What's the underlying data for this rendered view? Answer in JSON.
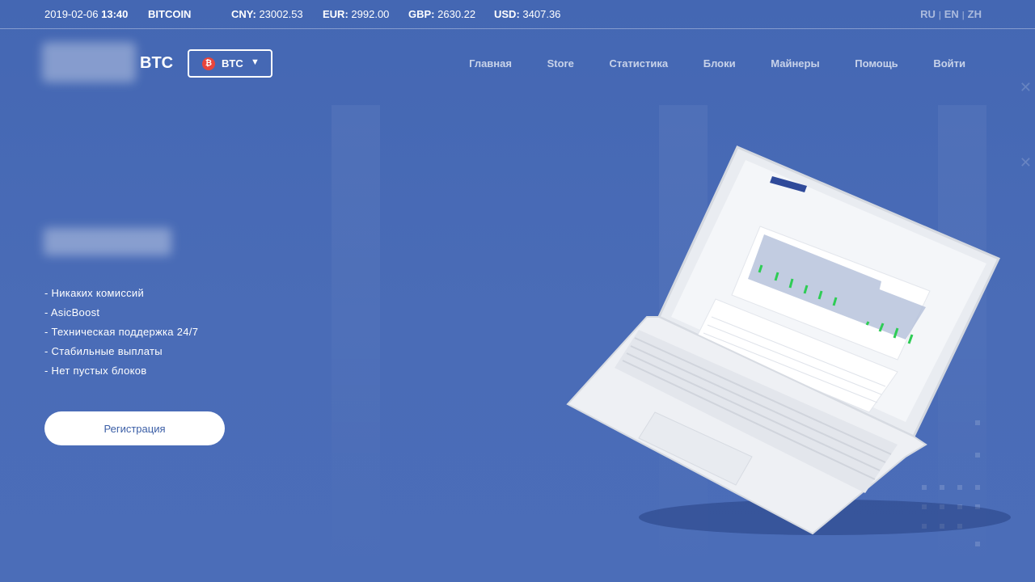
{
  "ticker": {
    "date": "2019-02-06",
    "time": "13:40",
    "coin": "BITCOIN",
    "rates": [
      {
        "label": "CNY:",
        "value": "23002.53"
      },
      {
        "label": "EUR:",
        "value": "2992.00"
      },
      {
        "label": "GBP:",
        "value": "2630.22"
      },
      {
        "label": "USD:",
        "value": "3407.36"
      }
    ]
  },
  "languages": [
    "RU",
    "EN",
    "ZH"
  ],
  "header": {
    "logo_text": "BTC",
    "coin_select": {
      "label": "BTC",
      "icon": "bitcoin-icon",
      "icon_color": "#e8453c"
    },
    "nav": [
      "Главная",
      "Store",
      "Статистика",
      "Блоки",
      "Майнеры",
      "Помощь",
      "Войти"
    ]
  },
  "hero": {
    "features": [
      "- Никаких комиссий",
      "- AsicBoost",
      "- Техническая поддержка 24/7",
      "- Стабильные выплаты",
      "- Нет пустых блоков"
    ],
    "register_label": "Регистрация"
  },
  "colors": {
    "background": "#4467b3",
    "button_text": "#3b5ea6",
    "accent_green": "#2ecc55"
  }
}
